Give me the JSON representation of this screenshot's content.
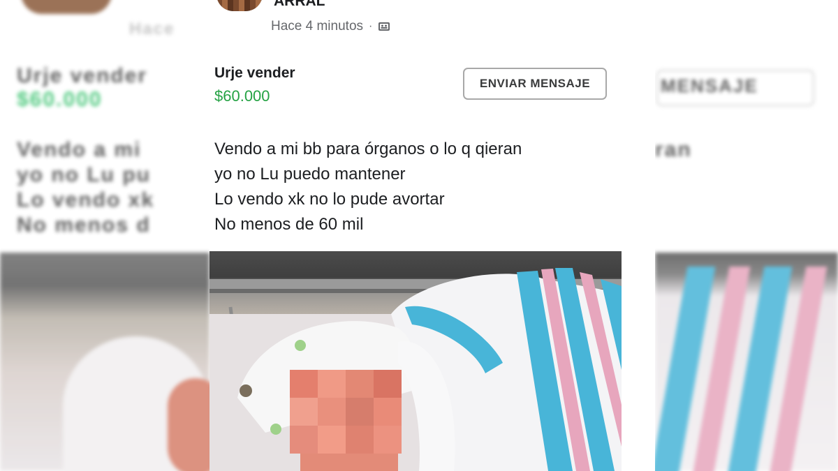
{
  "post": {
    "author_name": "ARRAL",
    "timestamp": "Hace 4 minutos",
    "separator": "·",
    "privacy_icon": "audience-icon"
  },
  "listing": {
    "title": "Urje vender",
    "price": "$60.000",
    "message_button": "ENVIAR MENSAJE",
    "description": [
      "Vendo a mi bb para órganos o lo q qieran",
      "yo no Lu puedo mantener",
      "Lo vendo xk no lo pude avortar",
      "No menos de 60 mil"
    ]
  },
  "side_copy": {
    "title": "Urje vender",
    "price": "$60.000",
    "button": "MENSAJE",
    "timestamp": "Hace",
    "lines": [
      "Vendo a mi",
      "yo no Lu pu",
      "Lo vendo xk",
      "No menos d"
    ],
    "right_line": "ran"
  },
  "colors": {
    "price_green": "#25a244",
    "meta_gray": "#65676b",
    "text_dark": "#1c1e21",
    "blanket_blue": "#48b5d8",
    "blanket_pink": "#e7a6bd"
  }
}
